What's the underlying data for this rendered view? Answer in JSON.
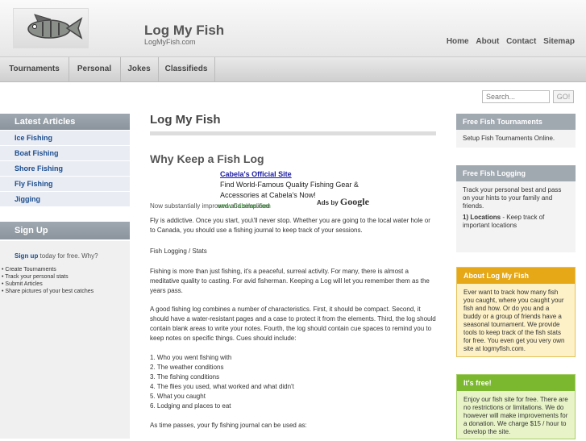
{
  "site": {
    "title": "Log My Fish",
    "subtitle": "LogMyFish.com"
  },
  "topnav": [
    "Home",
    "About",
    "Contact",
    "Sitemap"
  ],
  "tabs": [
    "Tournaments",
    "Personal",
    "Jokes",
    "Classifieds"
  ],
  "search": {
    "placeholder": "Search...",
    "button": "GO!"
  },
  "latest": {
    "title": "Latest Articles",
    "items": [
      "Ice Fishing",
      "Boat Fishing",
      "Shore Fishing",
      "Fly Fishing",
      "Jigging"
    ]
  },
  "signup": {
    "title": "Sign Up",
    "link": "Sign up",
    "text": " today for free. Why?",
    "items": [
      "Create Tournaments",
      "Track your personal stats",
      "Submit Articles",
      "Share pictures of your best catches"
    ]
  },
  "main": {
    "h1": "Log My Fish",
    "h2": "Why Keep a Fish Log",
    "ad_link": "Cabela's Official Site",
    "ad_text1": "Find World-Famous Quality Fishing Gear &",
    "ad_text2": "Accessories at Cabela's Now!",
    "ad_url": "www.Cabelas.com",
    "ads_by": "Ads by",
    "google": "Google",
    "p0": "Now substantially improved and simplified",
    "p1": "Fly is addictive. Once you start, you\\'ll never stop. Whether you are going to the local water hole or to Canada, you should use a fishing journal to keep track of your sessions.",
    "p2": "Fish Logging / Stats",
    "p3": "Fishing is more than just fishing, it's a peaceful, surreal activity. For many, there is almost a meditative quality to casting. For avid fisherman. Keeping a Log will let you remember them as the years pass.",
    "p4": "A good fishing log combines a number of characteristics. First, it should be compact. Second, it should have a water-resistant pages and a case to protect it from the elements. Third, the log should contain blank areas to write your notes. Fourth, the log should contain cue spaces to remind you to keep notes on specific things. Cues should include:",
    "list": [
      "1. Who you went fishing with",
      "2. The weather conditions",
      "3. The fishing conditions",
      "4. The flies you used, what worked and what didn't",
      "5. What you caught",
      "6. Lodging and places to eat"
    ],
    "p5": "As time passes, your fly fishing journal can be used as:"
  },
  "right": {
    "tourn_title": "Free Fish Tournaments",
    "tourn_body": "Setup Fish Tournaments Online.",
    "log_title": "Free Fish Logging",
    "log_body1": "Track your personal best and pass on your hints to your family and friends.",
    "log_body2_b": "1) Locations",
    "log_body2": " - Keep track of important locations",
    "about_title": "About Log My Fish",
    "about_body": "Ever want to track how many fish you caught, where you caught your fish and how. Or do you and a buddy or a group of friends have a seasonal tournament. We provide tools to keep track of the fish stats for free. You even get you very own site at logmyfish.com.",
    "free_title": "It's free!",
    "free_body": "Enjoy our fish site for free. There are no restrictions or limitations. We do however will make improvements for a donation. We charge $15 / hour to develop the site."
  },
  "colors": {
    "link": "#1b4d8f",
    "about": "#e6a817",
    "free": "#7cb82f",
    "box_head": "#a0a8b0"
  }
}
